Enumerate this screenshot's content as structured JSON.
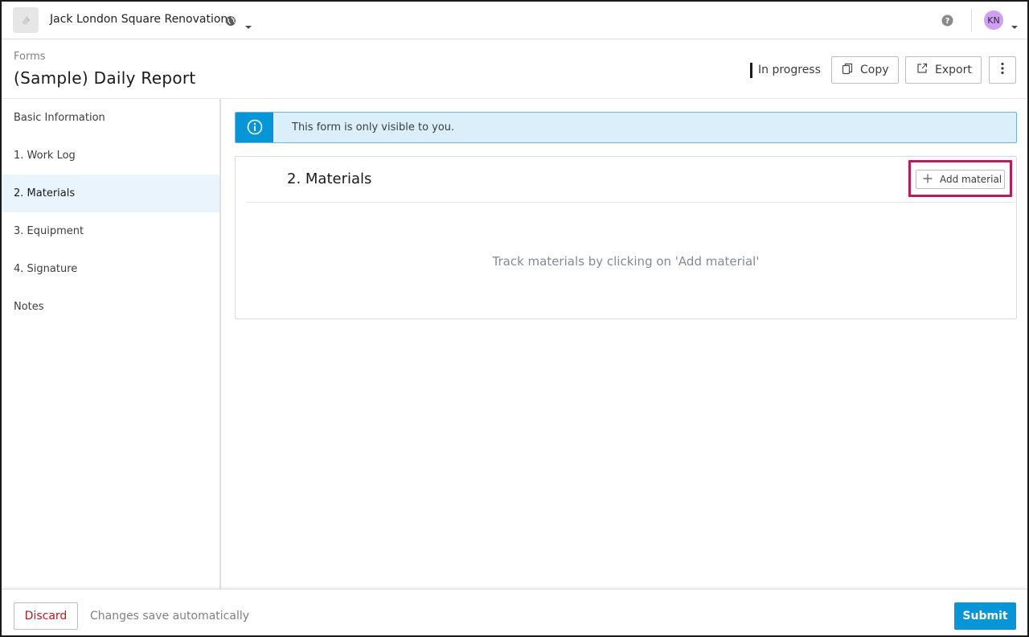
{
  "topbar": {
    "project_name": "Jack London Square Renovation",
    "logo_icon": "app-logo-icon",
    "user_initials": "KN",
    "avatar_color": "#cf9ef5"
  },
  "header": {
    "breadcrumb": "Forms",
    "title": "(Sample) Daily Report",
    "status": "In progress",
    "copy_label": "Copy",
    "export_label": "Export"
  },
  "sidebar": {
    "items": [
      {
        "label": "Basic Information"
      },
      {
        "label": "1. Work Log"
      },
      {
        "label": "2. Materials",
        "active": true
      },
      {
        "label": "3. Equipment"
      },
      {
        "label": "4. Signature"
      },
      {
        "label": "Notes"
      }
    ]
  },
  "banner": {
    "text": "This form is only visible to you.",
    "icon": "info-icon"
  },
  "section": {
    "title": "2. Materials",
    "add_label": "Add material",
    "empty_text": "Track materials by clicking on 'Add material'"
  },
  "footer": {
    "discard_label": "Discard",
    "autosave_text": "Changes save automatically",
    "submit_label": "Submit"
  },
  "colors": {
    "accent": "#0696d7",
    "highlight": "#c2185b",
    "discard": "#b71c1c",
    "active_nav": "#eaf4fc"
  }
}
